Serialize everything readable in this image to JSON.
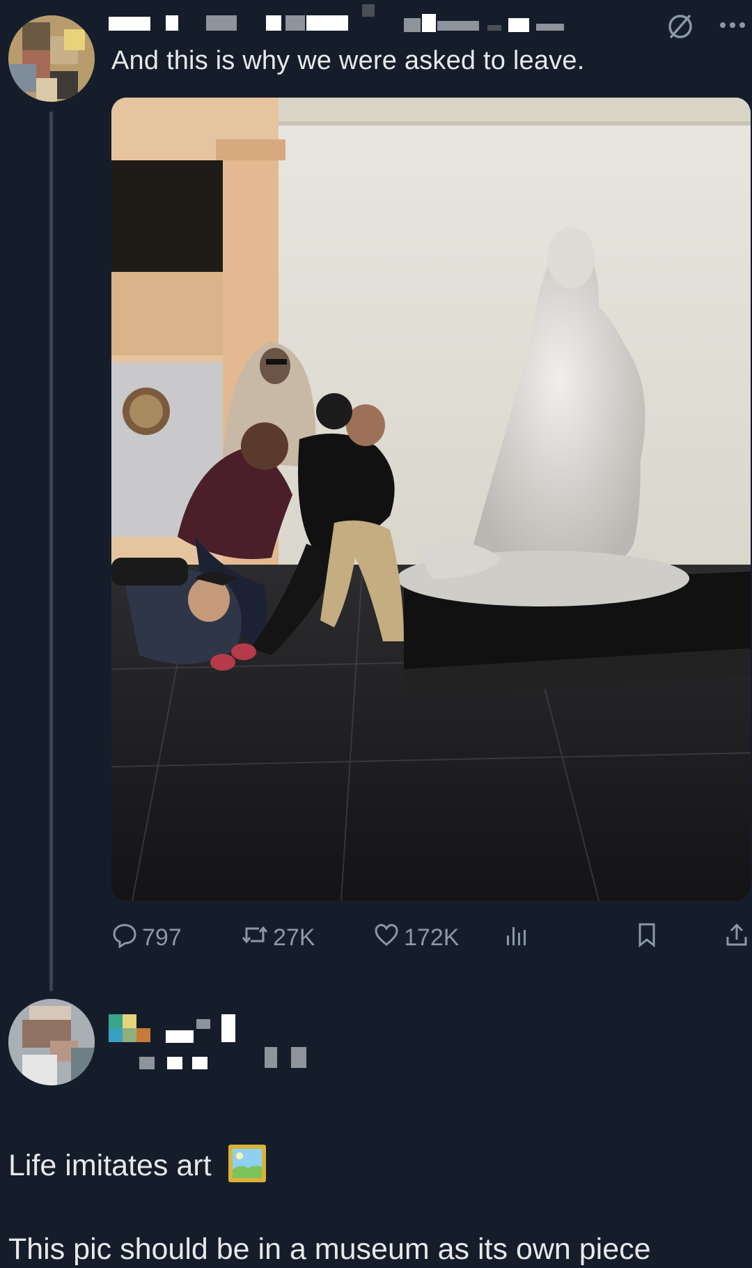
{
  "post": {
    "caption": "And this is why we were asked to leave.",
    "icons": {
      "grok": "slashed-circle-icon",
      "more": "more-dots-icon"
    },
    "actions": {
      "replies": "797",
      "reposts": "27K",
      "likes": "172K",
      "views_icon": "analytics-icon",
      "bookmark_icon": "bookmark-icon",
      "share_icon": "share-icon"
    }
  },
  "reply": {
    "line1": "Life imitates art",
    "emoji": "framed-picture-emoji",
    "line2": "This pic should be in a museum as its own piece"
  },
  "colors": {
    "background": "#151d2b",
    "text": "#e7e9ea",
    "muted": "#8b98a5"
  }
}
